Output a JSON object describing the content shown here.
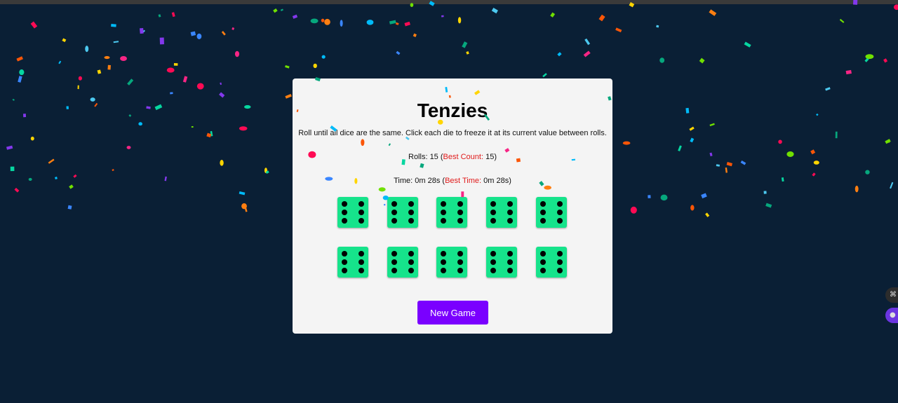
{
  "app": {
    "title": "Tenzies",
    "instructions": "Roll until all dice are the same. Click each die to freeze it at its current value between rolls."
  },
  "stats": {
    "rolls_label": "Rolls: ",
    "rolls": "15",
    "open_paren": " (",
    "best_count_label": "Best Count:",
    "best_count": " 15",
    "close_paren": ")",
    "time_label": "Time: ",
    "time": "0m 28s",
    "best_time_label": "Best Time:",
    "best_time": " 0m 28s"
  },
  "dice": [
    6,
    6,
    6,
    6,
    6,
    6,
    6,
    6,
    6,
    6
  ],
  "new_game_label": "New Game",
  "colors": {
    "background": "#0a1f35",
    "card": "#f4f4f4",
    "die": "#16e38b",
    "button": "#7a00ff",
    "best_highlight": "#e01b1b"
  },
  "icons": {
    "side_control_a": "command-icon",
    "side_control_b": "assistant-icon"
  },
  "confetti_colors": [
    "#ff0a54",
    "#ffd500",
    "#00bbf9",
    "#8338ec",
    "#06d6a0",
    "#ff7f11",
    "#3a86ff",
    "#70e000",
    "#f72585",
    "#4cc9f0",
    "#fb5607",
    "#06a77d"
  ]
}
